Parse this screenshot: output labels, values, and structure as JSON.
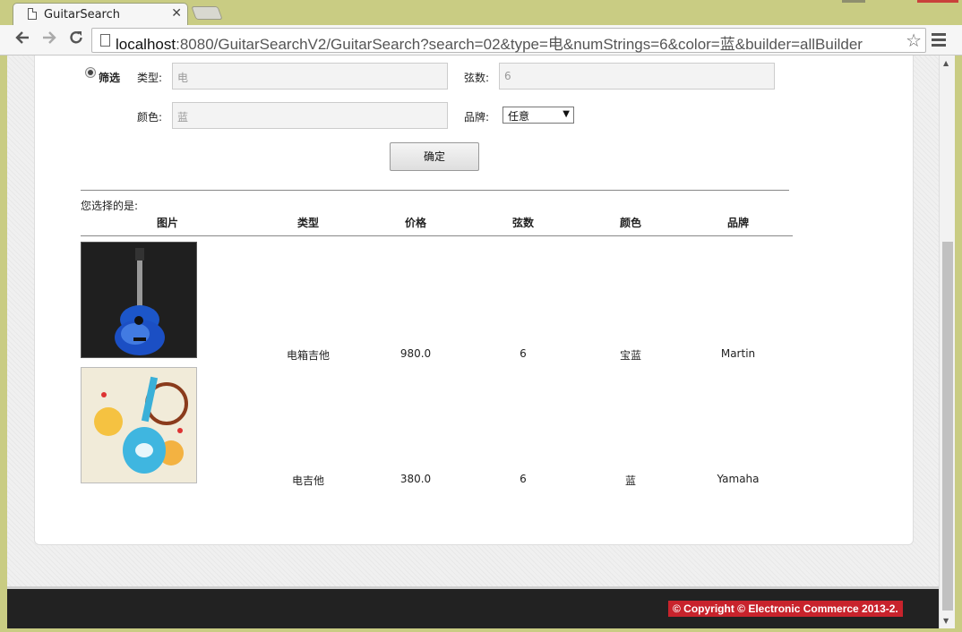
{
  "browser": {
    "tab_title": "GuitarSearch",
    "tab_close": "✕",
    "url_host": "localhost",
    "url_path": ":8080/GuitarSearchV2/GuitarSearch?search=02&type=电&numStrings=6&color=蓝&builder=allBuilder",
    "icons": [
      "page-icon",
      "back-icon",
      "forward-icon",
      "reload-icon",
      "star-icon",
      "menu-icon"
    ]
  },
  "filter": {
    "radio_label": "筛选",
    "type_label": "类型:",
    "type_value": "电",
    "strings_label": "弦数:",
    "strings_value": "6",
    "color_label": "颜色:",
    "color_value": "蓝",
    "brand_label": "品牌:",
    "brand_selected": "任意",
    "confirm_label": "确定"
  },
  "results": {
    "selected_label": "您选择的是:",
    "headers": [
      "图片",
      "类型",
      "价格",
      "弦数",
      "颜色",
      "品牌"
    ],
    "rows": [
      {
        "type": "电箱吉他",
        "price": "980.0",
        "strings": "6",
        "color": "宝蓝",
        "brand": "Martin"
      },
      {
        "type": "电吉他",
        "price": "380.0",
        "strings": "6",
        "color": "蓝",
        "brand": "Yamaha"
      }
    ]
  },
  "footer": {
    "copyright": "© Copyright © Electronic Commerce 2013-2."
  }
}
